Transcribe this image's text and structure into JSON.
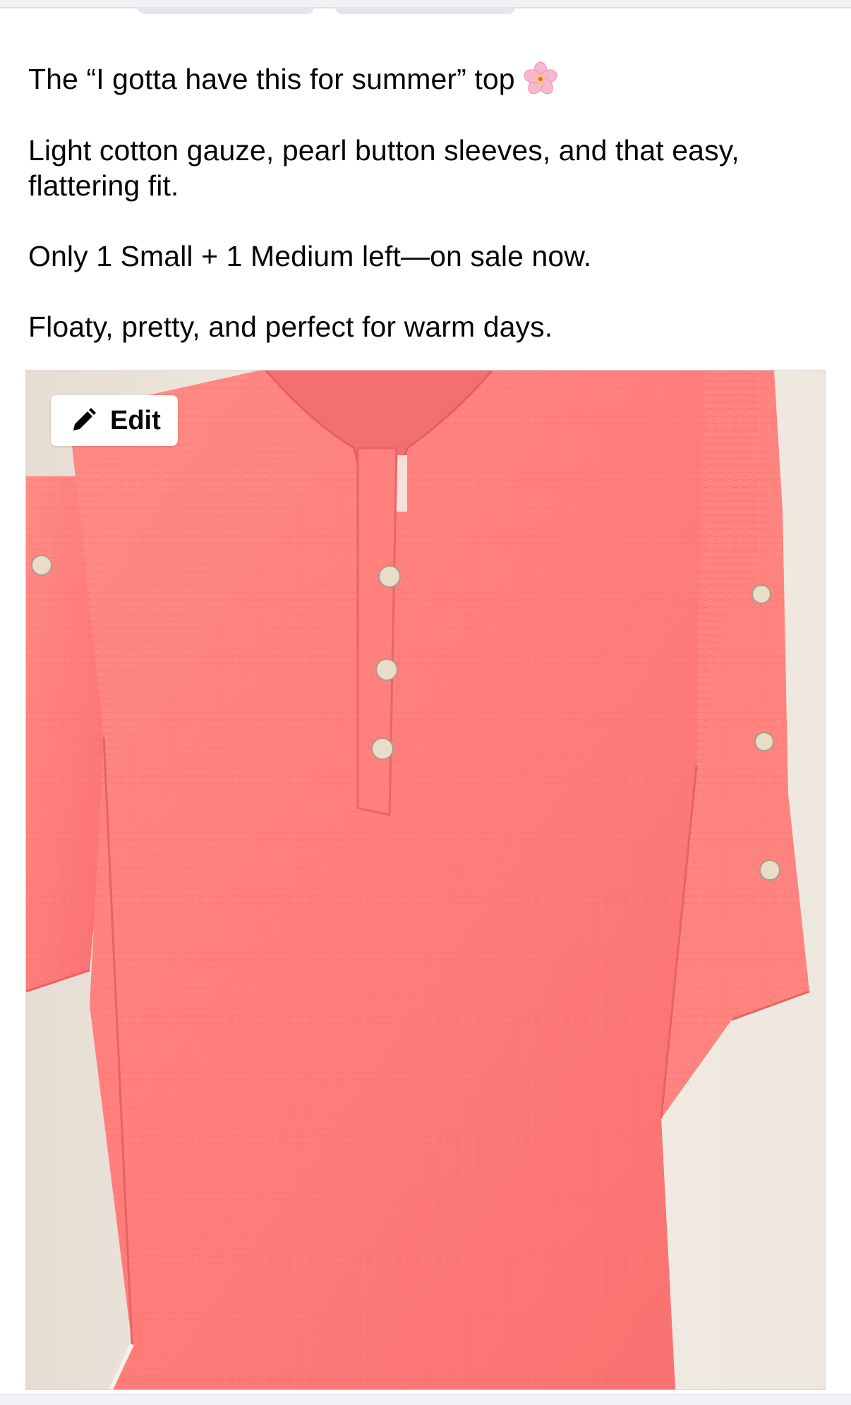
{
  "post": {
    "line1": "The “I gotta have this for summer” top",
    "line1_icon": "cherry-blossom-icon",
    "line2": "Light cotton gauze, pearl button sleeves, and that easy, flattering fit.",
    "line3": "Only 1 Small + 1 Medium left—on sale now.",
    "line4": "Floaty, pretty, and perfect for warm days."
  },
  "photo": {
    "subject": "coral-gauze-top",
    "edit_label": "Edit",
    "edit_icon": "pencil-icon"
  },
  "colors": {
    "text": "#050505",
    "shirt": "#ff7f7f",
    "background": "#ffffff"
  }
}
